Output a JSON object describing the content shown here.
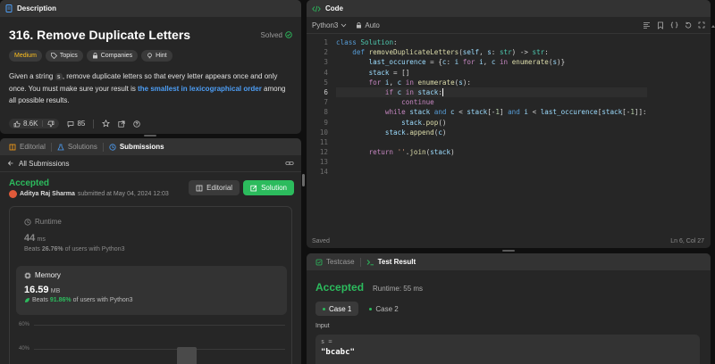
{
  "description_panel": {
    "tab_label": "Description",
    "problem_title": "316. Remove Duplicate Letters",
    "status": "Solved",
    "difficulty": "Medium",
    "tags": [
      "Topics",
      "Companies",
      "Hint"
    ],
    "body_1": "Given a string",
    "code_s": "s",
    "body_2": ", remove duplicate letters so that every letter appears once and only once. You must make sure your result is",
    "body_highlight": "the smallest in lexicographical order",
    "body_3": "among all possible results.",
    "likes": "8.6K",
    "comments": "85"
  },
  "submissions_panel": {
    "tabs": [
      "Editorial",
      "Solutions",
      "Submissions"
    ],
    "back_label": "All Submissions",
    "result": "Accepted",
    "author": "Aditya Raj Sharma",
    "submitted_text": "submitted at May 04, 2024 12:03",
    "editorial_btn": "Editorial",
    "solution_btn": "Solution",
    "runtime_label": "Runtime",
    "runtime_value": "44",
    "runtime_unit": "ms",
    "runtime_beats_label": "Beats",
    "runtime_beats_pct": "26.76%",
    "runtime_beats_suffix": "of users with Python3",
    "memory_label": "Memory",
    "memory_value": "16.59",
    "memory_unit": "MB",
    "memory_beats_label": "Beats",
    "memory_beats_pct": "91.86%",
    "memory_beats_suffix": "of users with Python3",
    "chart_ticks": [
      "60%",
      "40%"
    ]
  },
  "code_panel": {
    "tab_label": "Code",
    "language": "Python3",
    "mode": "Auto",
    "status": "Saved",
    "cursor": "Ln 6, Col 27",
    "line_numbers": [
      "1",
      "2",
      "3",
      "4",
      "5",
      "6",
      "7",
      "8",
      "9",
      "10",
      "11",
      "12",
      "13",
      "14"
    ]
  },
  "result_panel": {
    "tabs": [
      "Testcase",
      "Test Result"
    ],
    "result": "Accepted",
    "runtime": "Runtime: 55 ms",
    "cases": [
      "Case 1",
      "Case 2"
    ],
    "input_label": "Input",
    "input_var": "s =",
    "input_value": "\"bcabc\""
  },
  "colors": {
    "accepted": "#2cbb5d",
    "medium": "#ffc01e",
    "link": "#4d9ef6",
    "solution_btn": "#2cbb5d"
  }
}
